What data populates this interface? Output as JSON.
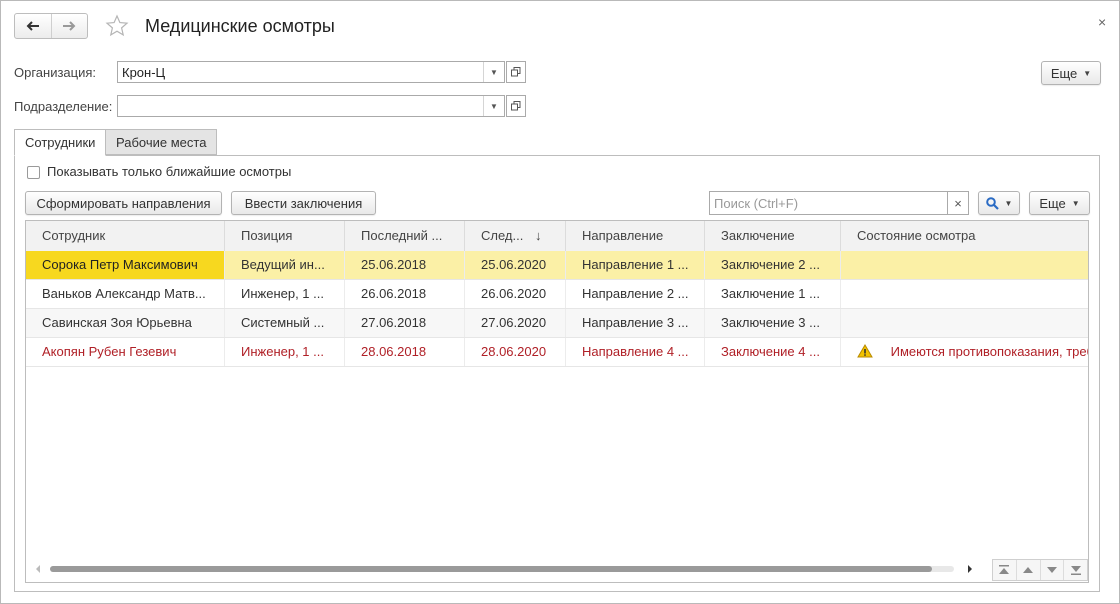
{
  "window": {
    "title": "Медицинские осмотры",
    "close_glyph": "×"
  },
  "nav": {
    "back_icon": "arrow-left-icon",
    "forward_icon": "arrow-right-icon",
    "favorite_icon": "star-icon"
  },
  "form": {
    "org_label": "Организация:",
    "org_value": "Крон-Ц",
    "dept_label": "Подразделение:",
    "dept_value": "",
    "more_label": "Еще"
  },
  "tabs": [
    {
      "label": "Сотрудники",
      "active": true
    },
    {
      "label": "Рабочие места",
      "active": false
    }
  ],
  "toolbar": {
    "checkbox_label": "Показывать только ближайшие осмотры",
    "checkbox_checked": false,
    "form_directions": "Сформировать направления",
    "enter_conclusions": "Ввести заключения",
    "search_placeholder": "Поиск (Ctrl+F)",
    "search_clear": "×",
    "more_label": "Еще"
  },
  "table": {
    "columns": [
      "Сотрудник",
      "Позиция",
      "Последний ...",
      "След...",
      "Направление",
      "Заключение",
      "Состояние осмотра"
    ],
    "sort_indicator": "↓",
    "rows": [
      [
        "Сорока Петр Максимович",
        "Ведущий ин...",
        "25.06.2018",
        "25.06.2020",
        "Направление 1 ...",
        "Заключение 2 ...",
        ""
      ],
      [
        "Ваньков Александр Матв...",
        "Инженер, 1 ...",
        "26.06.2018",
        "26.06.2020",
        "Направление 2 ...",
        "Заключение 1 ...",
        ""
      ],
      [
        "Савинская Зоя Юрьевна",
        "Системный ...",
        "27.06.2018",
        "27.06.2020",
        "Направление 3 ...",
        "Заключение 3 ...",
        ""
      ],
      [
        "Акопян Рубен Гезевич",
        "Инженер, 1 ...",
        "28.06.2018",
        "28.06.2020",
        "Направление 4 ...",
        "Заключение 4 ...",
        "Имеются противопоказания, треб"
      ]
    ]
  },
  "colors": {
    "selected_row": "#fbf0a6",
    "selected_cell": "#f7d81f",
    "warning_text": "#b02027",
    "warning_icon": "#f2c200"
  }
}
